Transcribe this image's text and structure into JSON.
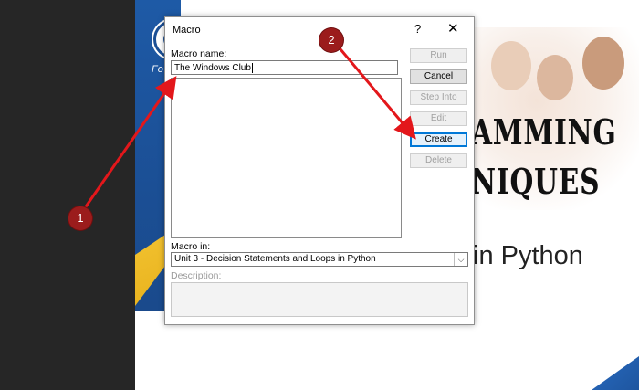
{
  "slide": {
    "logo_text": "Fo",
    "title_line1": "AMMING",
    "title_line2": "NIQUES",
    "subtitle": "in Python"
  },
  "dialog": {
    "title": "Macro",
    "help_label": "?",
    "close_label": "✕",
    "macro_name_label": "Macro name:",
    "macro_name_value": "The Windows Club",
    "macro_in_label": "Macro in:",
    "macro_in_value": "Unit 3 - Decision Statements and Loops in Python",
    "description_label": "Description:",
    "buttons": {
      "run": "Run",
      "cancel": "Cancel",
      "step_into": "Step Into",
      "edit": "Edit",
      "create": "Create",
      "delete": "Delete"
    }
  },
  "annotations": {
    "badge1": "1",
    "badge2": "2",
    "color": "#e3171b"
  },
  "icons": [
    "help-icon",
    "close-icon",
    "chevron-down-icon"
  ]
}
